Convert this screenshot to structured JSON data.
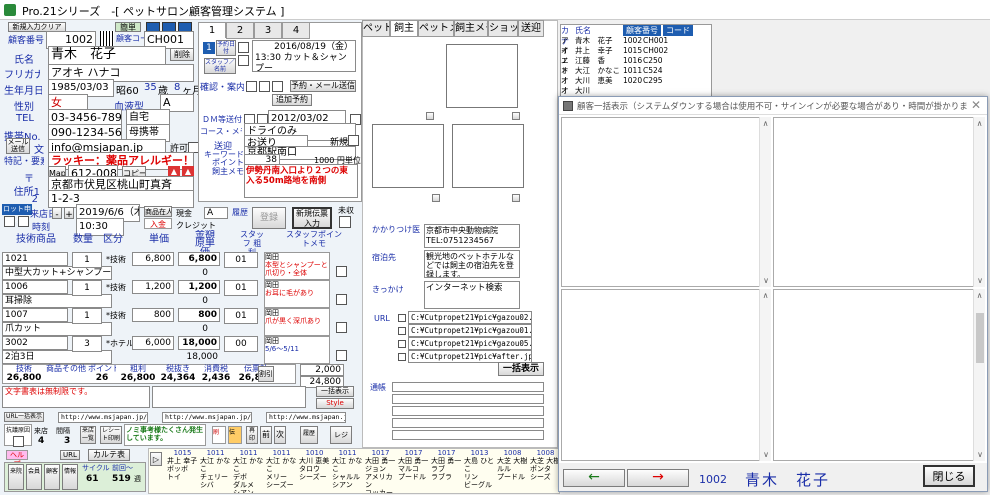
{
  "window": {
    "title": "Pro.21シリーズ　-[ ペットサロン顧客管理システム ]"
  },
  "header": {
    "new_customer_btn": "新規入力クリア",
    "customer_no_label": "顧客番号",
    "customer_no": "1002",
    "simple_btn": "簡単",
    "customer_code_label": "顧客コード",
    "customer_code": "CH001"
  },
  "customer": {
    "name_label": "氏名",
    "name": "青木　花子",
    "delete_btn": "削除",
    "kana_label": "フリガナ",
    "kana": "アオキ ハナコ",
    "birth_label": "生年月日",
    "birth": "1985/03/03",
    "era": "昭60",
    "age": "35",
    "age_unit": "歳",
    "months": "8",
    "month_unit": "ヶ月",
    "gender_label": "性別",
    "gender": "女",
    "blood_label": "血液型",
    "blood": "A",
    "tel_label": "TEL",
    "tel": "03-3456-7890",
    "tel_type": "自宅",
    "mobile_label": "携帯No.",
    "mobile": "090-1234-5678",
    "mobile_type": "母携帯",
    "mail_btn": "メール送信",
    "mail_label": "文",
    "email": "info@msjapan.jp",
    "permit": "許可",
    "note_label": "特記・要素",
    "note": "ラッキー：薬品アレルギー！",
    "zip_label": "〒",
    "map_btn": "Map",
    "zip": "612-0086",
    "copy_btn": "コピー",
    "addr1_label": "住所1",
    "addr1": "京都市伏見区桃山町真斉",
    "addr2_label": "2",
    "addr2": "1-2-3"
  },
  "tabs_center": [
    "1",
    "2",
    "3",
    "4"
  ],
  "visit": {
    "reserve_label": "予約日付",
    "date": "2016/08/19（金）",
    "time_course": "13:30 カット＆シャンプー",
    "staff_label": "スタッフ／名前",
    "confirm_label": "確認・案内",
    "reserve_mail_btn": "予約・メール送信",
    "add_reserve_btn": "追加予約",
    "dm_label": "ＤＭ等送付",
    "dm_date": "2012/03/02",
    "course_memo_label": "コース・メモ",
    "course_memo": "ドライのみ",
    "send_label": "送迎",
    "send_value": "お送り",
    "new_label": "新規",
    "keyword_label": "キーワード",
    "keyword": "京都駅南口",
    "point_label": "ポイント",
    "point": "38",
    "point_unit": "1000 円単位",
    "owner_memo_label": "飼主メモ",
    "owner_memo": "伊勢丹南入口より２つの東入る50m路地を南側"
  },
  "pet_tabs": [
    "ペット",
    "飼主",
    "ペットメモ",
    "飼主メモ",
    "ショップ",
    "送迎"
  ],
  "pet_info": {
    "vet_label": "かかりつけ医",
    "vet": "京都市中央動物病院 TEL:0751234567",
    "stay_label": "宿泊先",
    "stay": "観光地のペットホテルなどでは飼主の宿泊先を登録します。",
    "trigger_label": "きっかけ",
    "trigger": "インターネット検索",
    "url_label": "URL",
    "urls": [
      "C:¥Cutpropet21¥pic¥gazou02.jp:",
      "C:¥Cutpropet21¥pic¥gazou01.jp:",
      "C:¥Cutpropet21¥pic¥gazou05.jp:",
      "C:¥Cutpropet21¥pic¥after.jpg"
    ],
    "bulk_btn": "一括表示",
    "summary_label": "通帳"
  },
  "customer_list": {
    "headers": [
      "カナ",
      "氏名",
      "顧客番号",
      "コード"
    ],
    "rows": [
      {
        "kana": "アオ",
        "name": "青木　花子",
        "no": "1002",
        "code": "CH001"
      },
      {
        "kana": "イノ",
        "name": "井上　幸子",
        "no": "1015",
        "code": "CH002"
      },
      {
        "kana": "エト",
        "name": "江藤　香",
        "no": "1016",
        "code": "C250"
      },
      {
        "kana": "オオ",
        "name": "大江　かなこ",
        "no": "1011",
        "code": "C524"
      },
      {
        "kana": "オオ",
        "name": "大川　恵美",
        "no": "1020",
        "code": "C295"
      },
      {
        "kana": "オオ",
        "name": "大川　",
        "no": "",
        "code": ""
      }
    ]
  },
  "popup": {
    "title": "顧客一括表示（システムダウンする場合は使用不可・サインインが必要な場合があり・時間が掛かります・編集不可）",
    "customer_no": "1002",
    "customer_name": "青木　花子",
    "close_btn": "閉じる"
  },
  "sales": {
    "lot_label": "ロット申込",
    "date_label": "来店日",
    "date": "2019/6/6（木）",
    "time": "10:30",
    "product_label": "商品在人",
    "entry_label": "入金",
    "radio1": "現金",
    "radio2": "クレジット",
    "radio_val": "A",
    "history_label": "履歴",
    "register_btn": "登録",
    "new_slip_btn": "新規伝票入力",
    "unprinted_label": "未収",
    "col_headers": [
      "技術商品",
      "数量",
      "区分",
      "単価",
      "金額 原単価",
      "スタッフ 粗利",
      "スタッフポイントメモ"
    ],
    "rows": [
      {
        "code": "1021",
        "qty": "1",
        "kind": "*技術",
        "price": "6,800",
        "amount": "6,800",
        "staff": "01",
        "name": "中型大カット+シャンプー",
        "memo": "岡田",
        "memo2": "本型とシャンプーと爪切り・全体",
        "sub": "0"
      },
      {
        "code": "1006",
        "qty": "1",
        "kind": "*技術",
        "price": "1,200",
        "amount": "1,200",
        "staff": "01",
        "name": "耳掃除",
        "memo": "岡田",
        "memo2": "お耳に毛があり",
        "sub": "0"
      },
      {
        "code": "1007",
        "qty": "1",
        "kind": "*技術",
        "price": "800",
        "amount": "800",
        "staff": "01",
        "name": "爪カット",
        "memo": "岡田",
        "memo2": "爪が黒く深爪あり",
        "sub": "0"
      },
      {
        "code": "3002",
        "qty": "3",
        "kind": "*ホテル",
        "price": "6,000",
        "amount": "18,000",
        "staff": "00",
        "name": "2泊3日",
        "memo": "岡田",
        "memo2": "5/6～5/11",
        "sub": "18,000"
      }
    ],
    "totals_labels": [
      "技術",
      "商品その他",
      "ポイント",
      "粗利",
      "税抜き",
      "消費税",
      "伝票計"
    ],
    "totals": [
      "26,800",
      "",
      "26",
      "26,800",
      "24,364",
      "2,436",
      "26,800"
    ],
    "discount_label": "割引",
    "total_a": "2,000",
    "total_b": "24,800",
    "bulk_btn": "一括表示",
    "style_btn": "Style",
    "font_label": "文字書表は無制限です。"
  },
  "bottom": {
    "url_btn": "URL一括表示",
    "url1": "http://www.msjapan.jp/ga",
    "url2": "http://www.msjapan.jp/ga",
    "url3": "http://www.msjapan.jp/ga",
    "visit_count_label": "来店",
    "visit_count": "4",
    "visit_gap_label": "間隔",
    "visit_gap": "3",
    "compare_btn": "来店一覧",
    "receipt_btn": "レシート印刷",
    "attention_text": "ノミ事考様たくさん発生しています。",
    "btn_labels": [
      "前",
      "次",
      "カルテ表",
      "ヘルプ",
      "URL",
      "再印刷",
      "レジ"
    ],
    "help_btn": "ヘルプ",
    "url_btn2": "URL",
    "karte_btn": "カルテ表",
    "cycle_label": "サイクル",
    "cycle": "61",
    "prev_label": "前回〜",
    "prev": "519",
    "week_label": "週"
  },
  "karte_cols": [
    {
      "no": "1015",
      "text": "井上 幸子\nボッボ\nトイ"
    },
    {
      "no": "1011",
      "text": "大江 かなこ\nチェリー\nシバ"
    },
    {
      "no": "1011",
      "text": "大江 かなこ\nデボ\nダルメ\nシアン"
    },
    {
      "no": "1011",
      "text": "大江 かなこ\nメリー\nシーズー"
    },
    {
      "no": "1010",
      "text": "大川 恵美\nタロウ\nシーズー"
    },
    {
      "no": "1011",
      "text": "大江 かなこ\nシャルル\nシアン"
    },
    {
      "no": "1017",
      "text": "大田 勇一\nジョン\nアメリカン\nコッカー"
    },
    {
      "no": "1017",
      "text": "大田 勇一\nマルコ\nプードル"
    },
    {
      "no": "1017",
      "text": "大田 勇一\nラブ\nラブラ"
    },
    {
      "no": "1013",
      "text": "大島 ひとこ\nリン\nビーグル"
    },
    {
      "no": "1008",
      "text": "大芝 大樹\nルル\nプードル"
    },
    {
      "no": "1008",
      "text": "大芝 大樹\nポンタ\nシーズ"
    }
  ]
}
